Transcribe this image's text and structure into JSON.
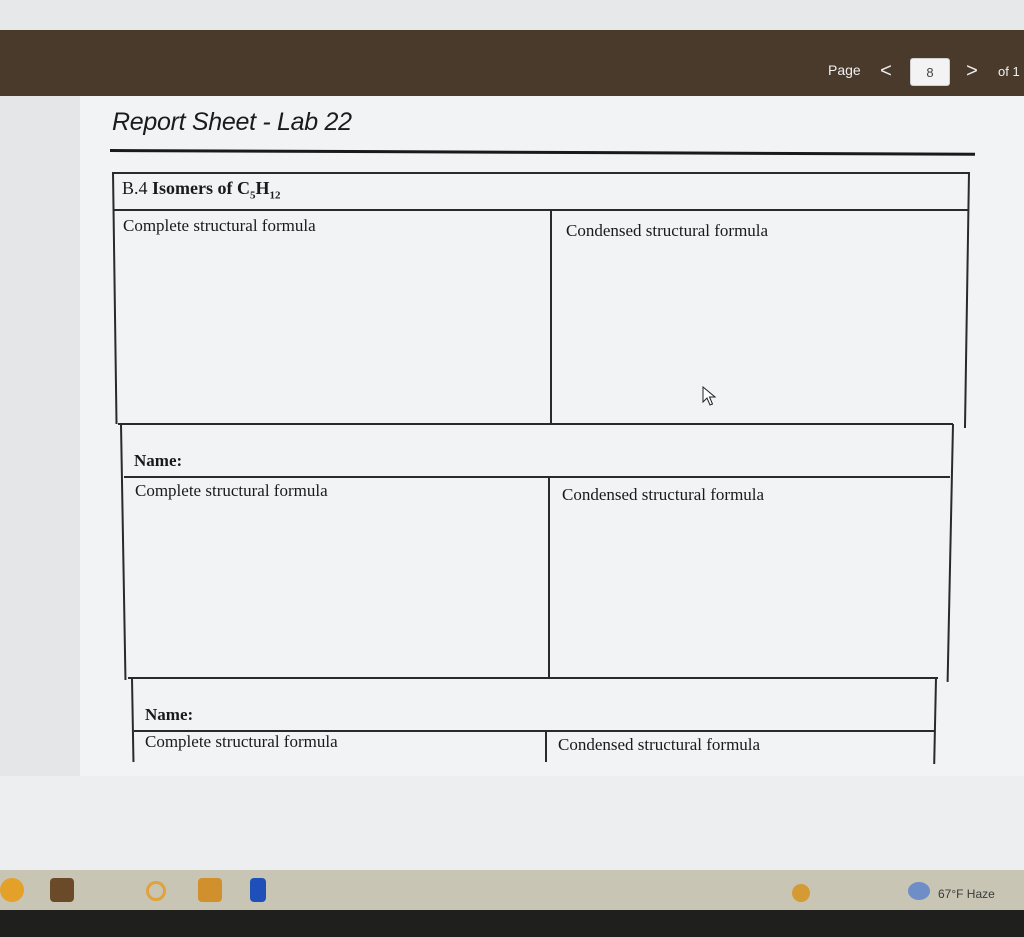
{
  "viewer": {
    "page_label": "Page",
    "prev_symbol": "<",
    "current_page": "8",
    "next_symbol": ">",
    "of_label": "of 1"
  },
  "document": {
    "title": "Report Sheet - Lab 22",
    "section": {
      "heading_prefix": "B.4",
      "heading_word": "Isomers of",
      "formula_c": "C",
      "formula_c_sub": "5",
      "formula_h": "H",
      "formula_h_sub": "12"
    },
    "blocks": [
      {
        "left_label": "Complete structural formula",
        "right_label": "Condensed structural formula"
      },
      {
        "name_label": "Name:",
        "left_label": "Complete structural formula",
        "right_label": "Condensed structural formula"
      },
      {
        "name_label": "Name:",
        "left_label": "Complete structural formula",
        "right_label": "Condensed structural formula"
      }
    ]
  },
  "taskbar": {
    "icons": [
      "edge-icon",
      "store-icon",
      "key-icon",
      "mail-icon",
      "phone-icon"
    ],
    "weather": "67°F Haze",
    "colors": {
      "toolbar": "#4a3a2c",
      "taskbar": "#c9c5b4"
    }
  }
}
